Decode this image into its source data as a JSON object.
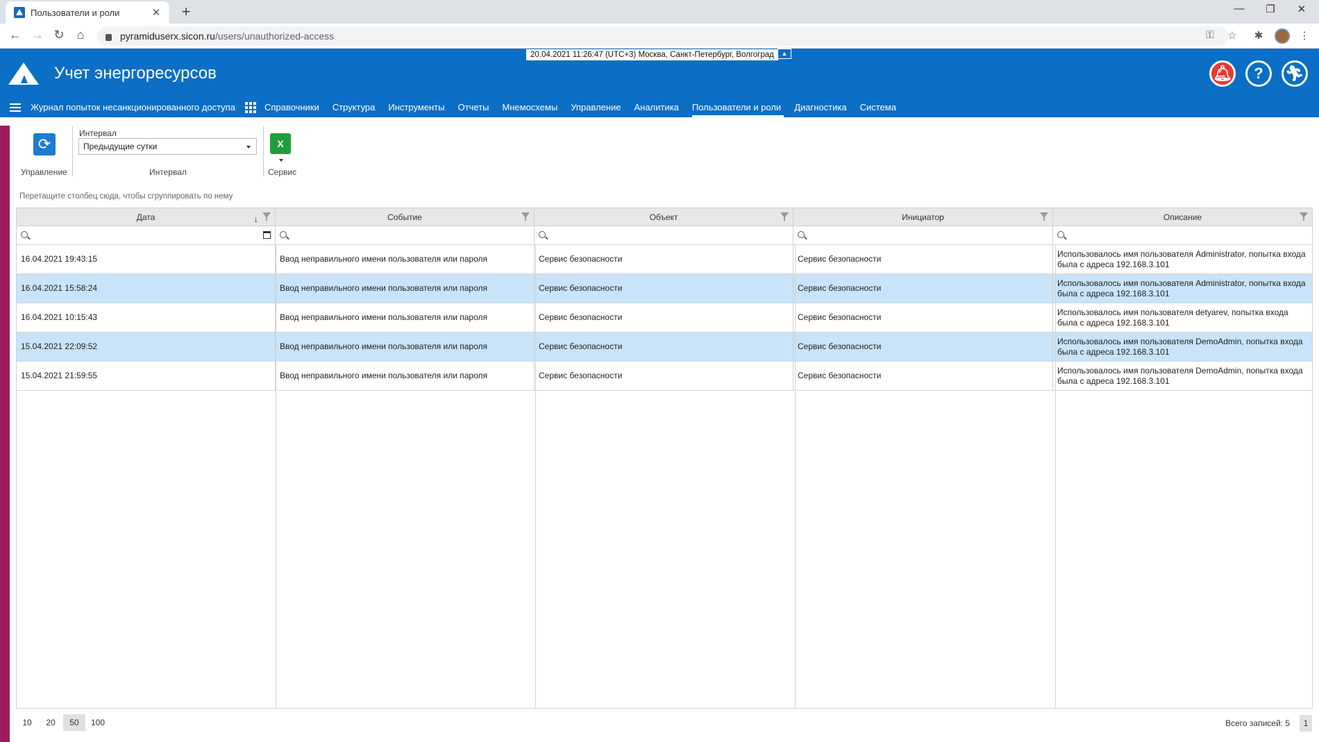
{
  "browser": {
    "tab_title": "Пользователи и роли",
    "url_host": "pyramiduserx.sicon.ru",
    "url_path": "/users/unauthorized-access"
  },
  "app": {
    "title": "Учет энергоресурсов",
    "clock": "20.04.2021 11:26:47 (UTC+3) Москва, Санкт-Петербург, Волгоград"
  },
  "menu": {
    "journal": "Журнал попыток несанкционированного доступа",
    "items": [
      "Справочники",
      "Структура",
      "Инструменты",
      "Отчеты",
      "Мнемосхемы",
      "Управление",
      "Аналитика",
      "Пользователи и роли",
      "Диагностика",
      "Система"
    ],
    "active": "Пользователи и роли"
  },
  "toolbar": {
    "control_label": "Управление",
    "interval_field_label": "Интервал",
    "interval_value": "Предыдущие сутки",
    "interval_group_label": "Интервал",
    "service_label": "Сервис"
  },
  "grid": {
    "group_hint": "Перетащите столбец сюда, чтобы сгруппировать по нему",
    "columns": [
      "Дата",
      "Событие",
      "Объект",
      "Инициатор",
      "Описание"
    ],
    "rows": [
      {
        "date": "16.04.2021 19:43:15",
        "event": "Ввод неправильного имени пользователя или пароля",
        "object": "Сервис безопасности",
        "initiator": "Сервис безопасности",
        "description": "Использовалось имя пользователя Administrator, попытка входа была с адреса 192.168.3.101"
      },
      {
        "date": "16.04.2021 15:58:24",
        "event": "Ввод неправильного имени пользователя или пароля",
        "object": "Сервис безопасности",
        "initiator": "Сервис безопасности",
        "description": "Использовалось имя пользователя Administrator, попытка входа была с адреса 192.168.3.101"
      },
      {
        "date": "16.04.2021 10:15:43",
        "event": "Ввод неправильного имени пользователя или пароля",
        "object": "Сервис безопасности",
        "initiator": "Сервис безопасности",
        "description": "Использовалось имя пользователя detyarev, попытка входа была с адреса 192.168.3.101"
      },
      {
        "date": "15.04.2021 22:09:52",
        "event": "Ввод неправильного имени пользователя или пароля",
        "object": "Сервис безопасности",
        "initiator": "Сервис безопасности",
        "description": "Использовалось имя пользователя DemoAdmin, попытка входа была с адреса 192.168.3.101"
      },
      {
        "date": "15.04.2021 21:59:55",
        "event": "Ввод неправильного имени пользователя или пароля",
        "object": "Сервис безопасности",
        "initiator": "Сервис безопасности",
        "description": "Использовалось имя пользователя DemoAdmin, попытка входа была с адреса 192.168.3.101"
      }
    ]
  },
  "pager": {
    "sizes": [
      "10",
      "20",
      "50",
      "100"
    ],
    "active_size": "50",
    "total": "Всего записей: 5",
    "page": "1"
  },
  "colors": {
    "header_bg": "#0a6fc5",
    "accent_strip": "#a01a5c",
    "selected_row": "#c9e3f8",
    "alert": "#e53935"
  }
}
